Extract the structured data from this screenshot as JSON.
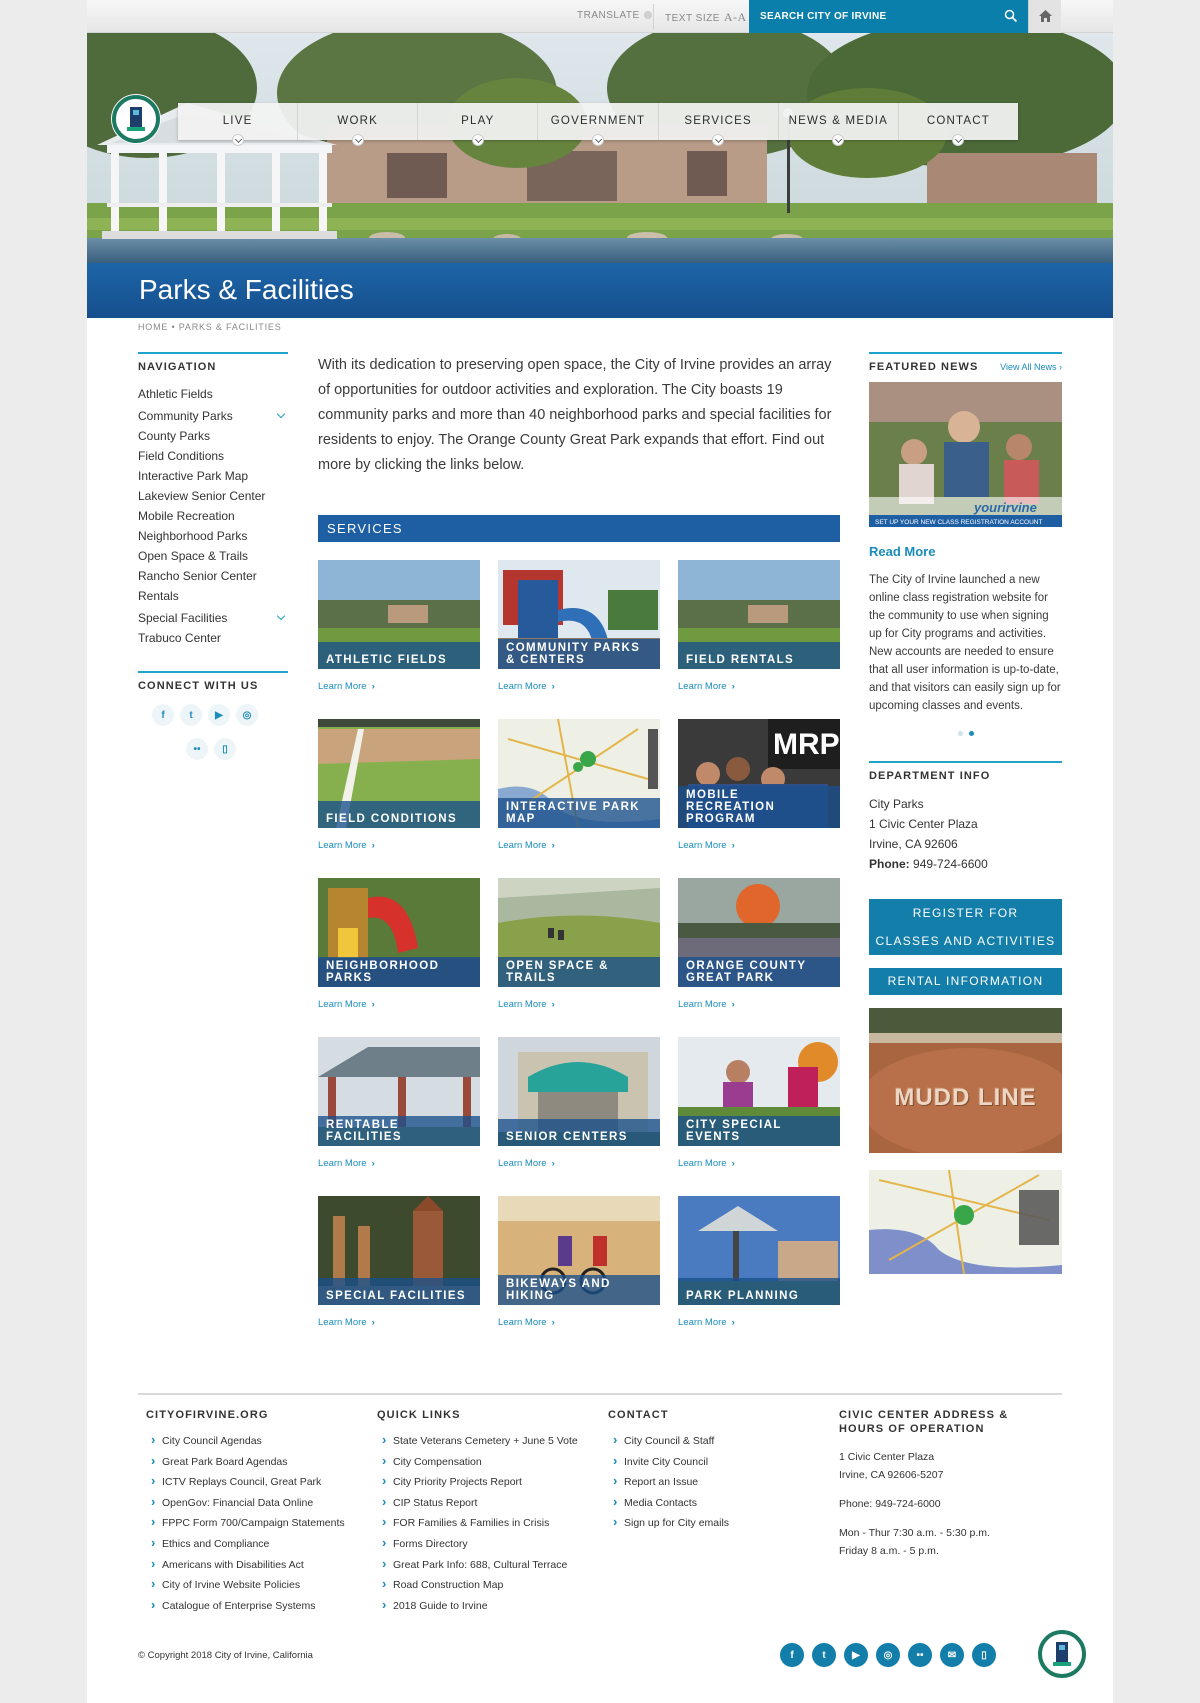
{
  "utility": {
    "translate": "TRANSLATE",
    "text_size": "TEXT SIZE",
    "text_size_glyph": "A-A",
    "search_placeholder": "SEARCH CITY OF IRVINE"
  },
  "logo": {
    "ring_text": "CITY OF IRVINE"
  },
  "nav": [
    "LIVE",
    "WORK",
    "PLAY",
    "GOVERNMENT",
    "SERVICES",
    "NEWS & MEDIA",
    "CONTACT"
  ],
  "page_title": "Parks & Facilities",
  "breadcrumb": "HOME • PARKS & FACILITIES",
  "left_nav": {
    "heading": "NAVIGATION",
    "items": [
      "Athletic Fields",
      "Community Parks",
      "County Parks",
      "Field Conditions",
      "Interactive Park Map",
      "Lakeview Senior Center",
      "Mobile Recreation",
      "Neighborhood Parks",
      "Open Space & Trails",
      "Rancho Senior Center",
      "Rentals",
      "Special Facilities",
      "Trabuco Center"
    ],
    "connect_heading": "CONNECT WITH US"
  },
  "intro": "With its dedication to preserving open space, the City of Irvine provides an array of opportunities for outdoor activities and exploration. The City boasts 19 community parks and more than 40 neighborhood parks and special facilities for residents to enjoy. The Orange County Great Park expands that effort. Find out more by clicking the links below.",
  "services": {
    "heading": "SERVICES",
    "learn_more": "Learn More",
    "tiles": [
      "ATHLETIC FIELDS",
      "COMMUNITY PARKS & CENTERS",
      "FIELD RENTALS",
      "FIELD CONDITIONS",
      "INTERACTIVE PARK MAP",
      "MOBILE RECREATION PROGRAM",
      "NEIGHBORHOOD PARKS",
      "OPEN SPACE & TRAILS",
      "ORANGE COUNTY GREAT PARK",
      "RENTABLE FACILITIES",
      "SENIOR CENTERS",
      "CITY SPECIAL EVENTS",
      "SPECIAL FACILITIES",
      "BIKEWAYS AND HIKING",
      "PARK PLANNING"
    ]
  },
  "featured": {
    "heading": "FEATURED NEWS",
    "view_all": "View All News",
    "banner_brand": "yourirvine",
    "banner_caption": "SET UP YOUR NEW CLASS REGISTRATION ACCOUNT",
    "read_more": "Read More",
    "text": "The City of Irvine launched a new online class registration website for the community to use when signing up for City programs and activities. New accounts are needed to ensure that all user information is up-to-date, and that visitors can easily sign up for upcoming classes and events."
  },
  "dept": {
    "heading": "DEPARTMENT INFO",
    "name": "City Parks",
    "street": "1 Civic Center Plaza",
    "city": "Irvine, CA 92606",
    "phone_label": "Phone:",
    "phone": "949-724-6600"
  },
  "buttons": {
    "register_line1": "REGISTER FOR",
    "register_line2": "CLASSES AND ACTIVITIES",
    "rental": "RENTAL INFORMATION"
  },
  "mudd_text": "MUDD LINE",
  "footer": {
    "col1": {
      "heading": "CITYOFIRVINE.ORG",
      "links": [
        "City Council Agendas",
        "Great Park Board Agendas",
        "ICTV Replays Council, Great Park",
        "OpenGov: Financial Data Online",
        "FPPC Form 700/Campaign Statements",
        "Ethics and Compliance",
        "Americans with Disabilities Act",
        "City of Irvine Website Policies",
        "Catalogue of Enterprise Systems"
      ]
    },
    "col2": {
      "heading": "QUICK LINKS",
      "links": [
        "State Veterans Cemetery + June 5 Vote",
        "City Compensation",
        "City Priority Projects Report",
        "CIP Status Report",
        "FOR Families & Families in Crisis",
        "Forms Directory",
        "Great Park Info: 688, Cultural Terrace",
        "Road Construction Map",
        "2018 Guide to Irvine"
      ]
    },
    "col3": {
      "heading": "CONTACT",
      "links": [
        "City Council & Staff",
        "Invite City Council",
        "Report an Issue",
        "Media Contacts",
        "Sign up for City emails"
      ]
    },
    "col4": {
      "heading": "CIVIC CENTER ADDRESS & HOURS OF OPERATION",
      "street": "1 Civic Center Plaza",
      "city": "Irvine, CA 92606-5207",
      "phone": "Phone: 949-724-6000",
      "hours1": "Mon - Thur 7:30 a.m. - 5:30 p.m.",
      "hours2": "Friday 8 a.m. - 5 p.m."
    },
    "copyright": "© Copyright 2018 City of Irvine, California"
  },
  "icons": {
    "social": [
      "facebook-icon",
      "twitter-icon",
      "youtube-icon",
      "instagram-icon",
      "flickr-icon",
      "email-icon",
      "mobile-icon"
    ]
  },
  "colors": {
    "accent_blue": "#0b7fab",
    "title_blue": "#1d65a8",
    "link_blue": "#1a8dbb",
    "rule_cyan": "#22a3c9"
  }
}
